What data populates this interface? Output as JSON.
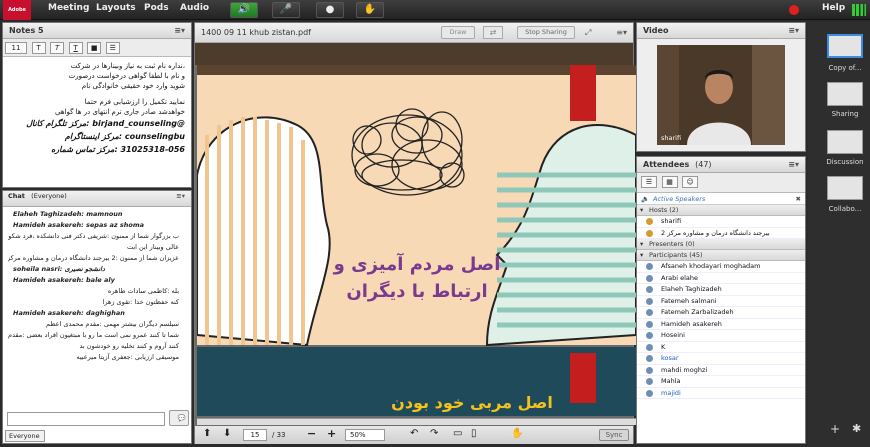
{
  "topbar": {
    "logo": "Adobe",
    "menus": [
      "Meeting",
      "Layouts",
      "Pods",
      "Audio"
    ],
    "help": "Help"
  },
  "notes": {
    "title": "Notes 5",
    "font_size": "11",
    "lines": [
      {
        "text": "،نداره نام ثبت به نیاز وبینارها در شرکت",
        "en": false
      },
      {
        "text": "و نام با لطفا گواهی درخواست درصورت",
        "en": false
      },
      {
        "text": "شوید وارد خود حقیقی خانوادگی نام",
        "en": false
      },
      {
        "text": "",
        "en": false
      },
      {
        "text": "نمایید تکمیل را ارزشیابی فرم حتما",
        "en": false
      },
      {
        "text": "خواهدشد صادر جاری ترم انتهای در ها گواهی",
        "en": false
      },
      {
        "text": "@birjand_counseling :مرکز تلگرام کانال",
        "en": true
      },
      {
        "text": "counselingbu :مرکز اینستاگرام",
        "en": true
      },
      {
        "text": "31025318-056 :مرکز تماس شماره",
        "en": true
      }
    ]
  },
  "chat": {
    "title": "Chat",
    "scope": "(Everyone)",
    "messages": [
      {
        "text": "Elaheh Taghizadeh: mamnoun",
        "who": true,
        "rtl": false
      },
      {
        "text": "Hamideh asakereh: sepas az shoma",
        "who": true,
        "rtl": false
      },
      {
        "text": "ب بزرگوار شما از ممنون :شریفی دکتر فنی دانشکده ،فرد شکوهی فاطمه",
        "who": false,
        "rtl": true
      },
      {
        "text": "عالی وبینار این ابت",
        "who": false,
        "rtl": true
      },
      {
        "text": "عزیزان شما از ممنون :2 بیرجند دانشگاه درمان و مشاوره مرکز",
        "who": false,
        "rtl": true
      },
      {
        "text": "soheila nasri: دانشجو نصیری",
        "who": true,
        "rtl": false
      },
      {
        "text": "Hamideh asakereh: bale aly",
        "who": true,
        "rtl": false
      },
      {
        "text": "بله :کاظمی سادات طاهره",
        "who": false,
        "rtl": true
      },
      {
        "text": "کنه حفظتون خدا :تقوی زهرا",
        "who": false,
        "rtl": true
      },
      {
        "text": "Hamideh asakereh: daghighan",
        "who": true,
        "rtl": false
      },
      {
        "text": "سیلسم دیگران بیشتر مهمی :مقدم محمدی اعظم",
        "who": false,
        "rtl": true
      },
      {
        "text": "شما تا کنند عمرو نمی است ما رو با مبتغیون افراد بعضی :مقدم محمدی اعظم",
        "who": false,
        "rtl": true
      },
      {
        "text": "کنند آروم و کنند تخلیه رو خودشون بد",
        "who": false,
        "rtl": true
      },
      {
        "text": "موسیقی ارزیابی :جعفری آزیتا میرعبیه",
        "who": false,
        "rtl": true
      }
    ],
    "recipient": "Everyone"
  },
  "share": {
    "title": "1400 09 11 khub zistan.pdf",
    "draw": "Draw",
    "stop": "Stop Sharing",
    "page": "15",
    "total": "/ 33",
    "zoom": "50%",
    "sync": "Sync",
    "slide_title_1": "اصل مردم آمیزی و",
    "slide_title_2": "ارتباط با دیگران",
    "slide_bottom": "اصل مربی خود بودن"
  },
  "video": {
    "title": "Video",
    "name": "sharifi"
  },
  "attendees": {
    "title": "Attendees",
    "count": "(47)",
    "active": "Active Speakers",
    "hosts_label": "Hosts (2)",
    "hosts": [
      "sharifi",
      "2 بیرجند دانشگاه درمان و مشاوره مرکز"
    ],
    "presenters_label": "Presenters (0)",
    "participants_label": "Participants (45)",
    "participants": [
      {
        "name": "Afsaneh khodayari moghadam",
        "blue": false
      },
      {
        "name": "Arabi elahe",
        "blue": false
      },
      {
        "name": "Elaheh Taghizadeh",
        "blue": false
      },
      {
        "name": "Fatemeh salmani",
        "blue": false
      },
      {
        "name": "Fatemeh Zarbalizadeh",
        "blue": false
      },
      {
        "name": "Hamideh asakereh",
        "blue": false
      },
      {
        "name": "Hoseini",
        "blue": false
      },
      {
        "name": "K",
        "blue": false
      },
      {
        "name": "kosar",
        "blue": true
      },
      {
        "name": "mahdi moghzi",
        "blue": false
      },
      {
        "name": "Mahla",
        "blue": false
      },
      {
        "name": "majidi",
        "blue": true
      }
    ]
  },
  "layouts": [
    {
      "label": "Copy of..."
    },
    {
      "label": "Sharing"
    },
    {
      "label": "Discussion"
    },
    {
      "label": "Collabo..."
    }
  ],
  "colors": {
    "slide_bg": "#f8d9b6",
    "slide_title": "#7a3a8f",
    "slide_band": "#1e4a5a",
    "slide_bottom_text": "#f4c21c",
    "accent_red": "#c41e1e"
  }
}
